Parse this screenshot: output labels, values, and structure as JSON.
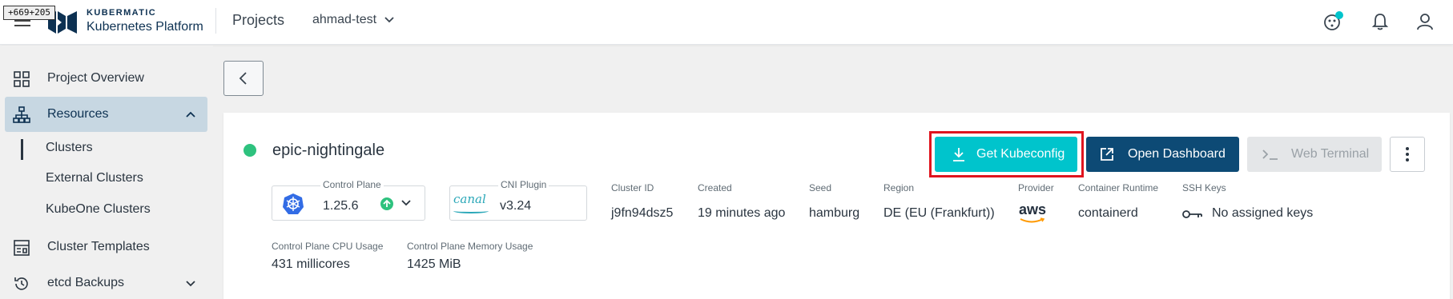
{
  "overlay": {
    "coord_text": "+669+205"
  },
  "header": {
    "brand_top": "KUBERMATIC",
    "brand_bottom": "Kubernetes Platform",
    "projects_label": "Projects",
    "project_name": "ahmad-test",
    "icons": [
      "theme-icon",
      "notifications-icon",
      "account-icon"
    ]
  },
  "sidebar": {
    "items": [
      {
        "label": "Project Overview",
        "icon": "grid-icon"
      },
      {
        "label": "Resources",
        "icon": "hierarchy-icon",
        "active": true,
        "expanded": true
      },
      {
        "label": "Cluster Templates",
        "icon": "template-icon"
      },
      {
        "label": "etcd Backups",
        "icon": "history-icon"
      }
    ],
    "sub_items": [
      "Clusters",
      "External Clusters",
      "KubeOne Clusters"
    ]
  },
  "cluster": {
    "name": "epic-nightingale",
    "status_color": "#2ec27e",
    "buttons": {
      "kubeconfig": "Get Kubeconfig",
      "dashboard": "Open Dashboard",
      "terminal": "Web Terminal"
    },
    "control_plane": {
      "label": "Control Plane",
      "version": "1.25.6"
    },
    "cni_plugin": {
      "label": "CNI Plugin",
      "logo_text": "canal",
      "version": "v3.24"
    },
    "info": [
      {
        "label": "Cluster ID",
        "value": "j9fn94dsz5"
      },
      {
        "label": "Created",
        "value": "19 minutes ago"
      },
      {
        "label": "Seed",
        "value": "hamburg"
      },
      {
        "label": "Region",
        "value": "DE (EU (Frankfurt))"
      },
      {
        "label": "Provider",
        "value": "aws"
      },
      {
        "label": "Container Runtime",
        "value": "containerd"
      },
      {
        "label": "SSH Keys",
        "value": "No assigned keys"
      }
    ],
    "usage": [
      {
        "label": "Control Plane CPU Usage",
        "value": "431 millicores"
      },
      {
        "label": "Control Plane Memory Usage",
        "value": "1425 MiB"
      }
    ]
  },
  "colors": {
    "accent": "#00c4cc",
    "primary_dark": "#0d4a75",
    "highlight": "#e0141e",
    "sidebar_active": "#c7d7e2"
  }
}
